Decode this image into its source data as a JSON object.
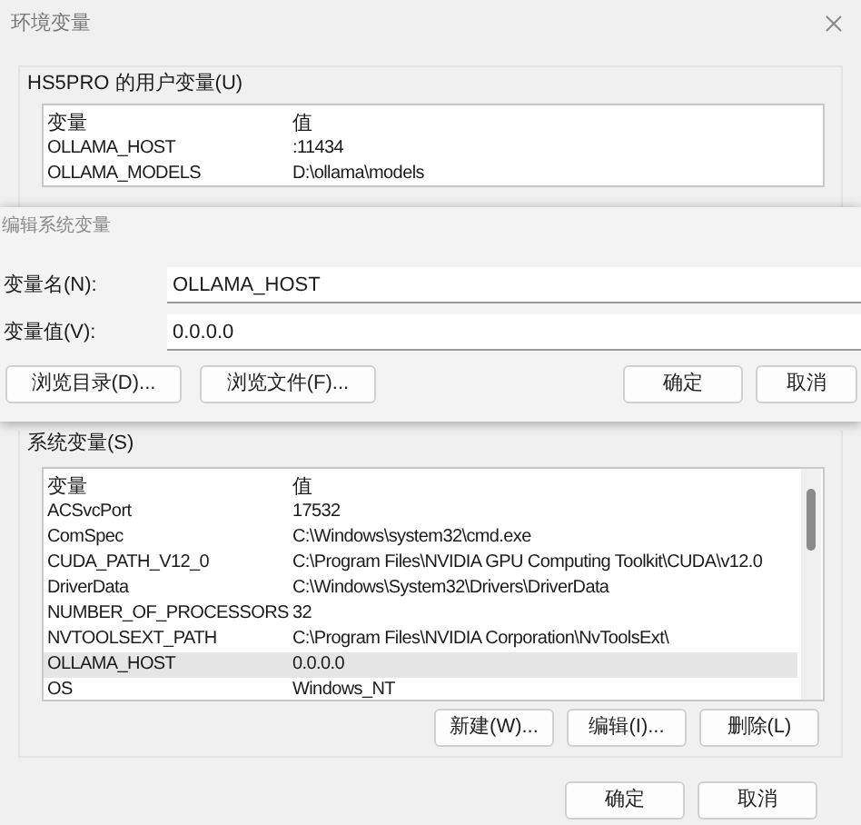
{
  "window": {
    "title": "环境变量"
  },
  "user_variables": {
    "label": "HS5PRO 的用户变量(U)",
    "columns": [
      "变量",
      "值"
    ],
    "rows": [
      {
        "name": "OLLAMA_HOST",
        "value": ":11434",
        "selected": false
      },
      {
        "name": "OLLAMA_MODELS",
        "value": "D:\\ollama\\models",
        "selected": false
      }
    ]
  },
  "edit_dialog": {
    "title": "编辑系统变量",
    "fields": [
      {
        "label": "变量名(N):",
        "value": "OLLAMA_HOST"
      },
      {
        "label": "变量值(V):",
        "value": "0.0.0.0"
      }
    ],
    "left_buttons": [
      "浏览目录(D)...",
      "浏览文件(F)..."
    ],
    "right_buttons": [
      "确定",
      "取消"
    ]
  },
  "system_variables": {
    "label": "系统变量(S)",
    "columns": [
      "变量",
      "值"
    ],
    "rows": [
      {
        "name": "ACSvcPort",
        "value": "17532",
        "selected": false
      },
      {
        "name": "ComSpec",
        "value": "C:\\Windows\\system32\\cmd.exe",
        "selected": false
      },
      {
        "name": "CUDA_PATH_V12_0",
        "value": "C:\\Program Files\\NVIDIA GPU Computing Toolkit\\CUDA\\v12.0",
        "selected": false
      },
      {
        "name": "DriverData",
        "value": "C:\\Windows\\System32\\Drivers\\DriverData",
        "selected": false
      },
      {
        "name": "NUMBER_OF_PROCESSORS",
        "value": "32",
        "selected": false
      },
      {
        "name": "NVTOOLSEXT_PATH",
        "value": "C:\\Program Files\\NVIDIA Corporation\\NvToolsExt\\",
        "selected": false
      },
      {
        "name": "OLLAMA_HOST",
        "value": "0.0.0.0",
        "selected": true
      },
      {
        "name": "OS",
        "value": "Windows_NT",
        "selected": false
      }
    ],
    "buttons": [
      "新建(W)...",
      "编辑(I)...",
      "删除(L)"
    ]
  },
  "footer_buttons": [
    "确定",
    "取消"
  ]
}
